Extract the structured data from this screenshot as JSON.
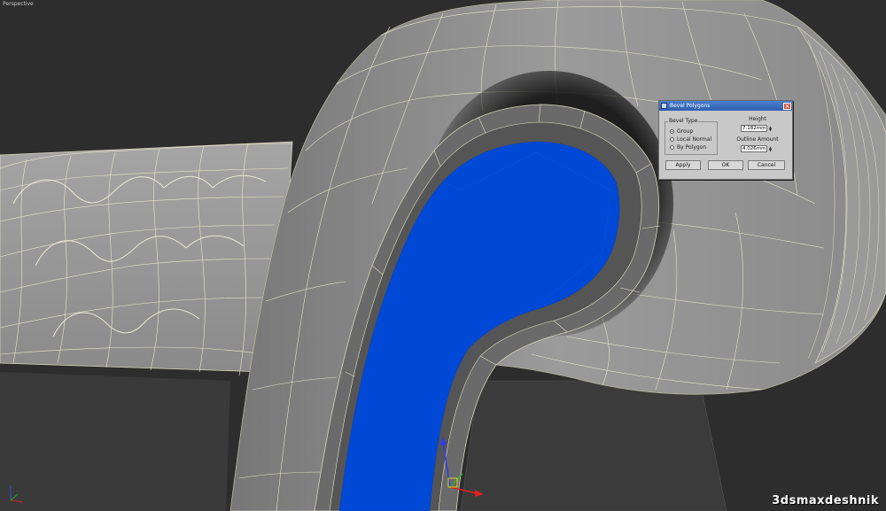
{
  "viewport": {
    "label": "Perspective",
    "watermark": "3dsmaxdeshnik",
    "colors": {
      "background": "#2d2d2d",
      "mesh": "#8e8e8e",
      "wire": "#e3e0c8",
      "selection": "#0049d6"
    }
  },
  "dialog": {
    "title": "Bevel Polygons",
    "title_icon": "max-app-icon",
    "close_icon": "close-icon",
    "bevel_type": {
      "label": "Bevel Type",
      "options": [
        "Group",
        "Local Normal",
        "By Polygon"
      ],
      "selected": "Group"
    },
    "height": {
      "label": "Height",
      "value": "7.182mm"
    },
    "outline_amount": {
      "label": "Outline Amount",
      "value": "4.026mm"
    },
    "buttons": {
      "apply": "Apply",
      "ok": "OK",
      "cancel": "Cancel"
    }
  }
}
